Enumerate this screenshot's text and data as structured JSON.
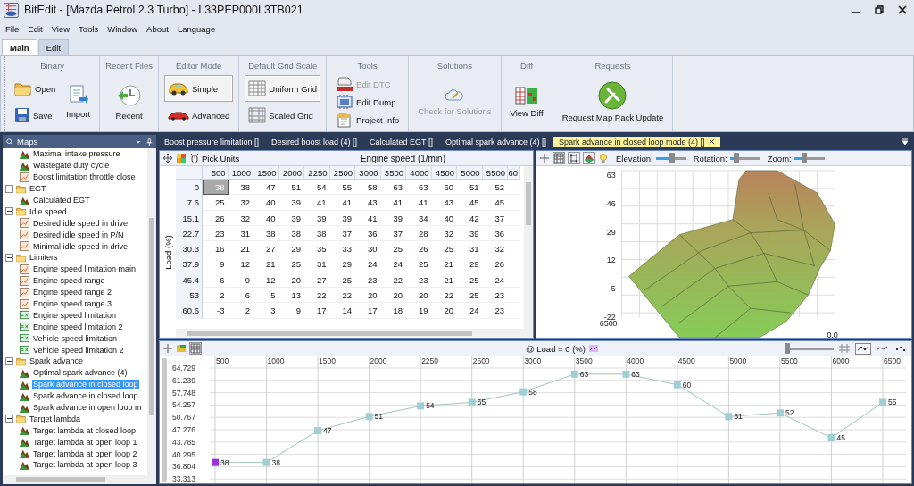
{
  "window": {
    "title": "BitEdit - [Mazda Petrol 2.3 Turbo] - L33PEP000L3TB021"
  },
  "menu": [
    "File",
    "Edit",
    "View",
    "Tools",
    "Window",
    "About",
    "Language"
  ],
  "ribbon_tabs": [
    {
      "label": "Main",
      "selected": true
    },
    {
      "label": "Edit",
      "selected": false
    }
  ],
  "ribbon_groups": [
    {
      "title": "Binary",
      "buttons": [
        {
          "label": "Open",
          "kind": "small",
          "selected": false,
          "disabled": false
        },
        {
          "label": "Save",
          "kind": "small",
          "selected": false,
          "disabled": false
        },
        {
          "label": "Import",
          "kind": "large",
          "selected": false,
          "disabled": false
        }
      ]
    },
    {
      "title": "Recent Files",
      "buttons": [
        {
          "label": "Recent",
          "kind": "large",
          "selected": false,
          "disabled": false
        }
      ]
    },
    {
      "title": "Editor Mode",
      "buttons": [
        {
          "label": "Simple",
          "kind": "small",
          "selected": true,
          "disabled": false
        },
        {
          "label": "Advanced",
          "kind": "small",
          "selected": false,
          "disabled": false
        }
      ]
    },
    {
      "title": "Default Grid Scale",
      "buttons": [
        {
          "label": "Uniform Grid",
          "kind": "small",
          "selected": true,
          "disabled": false
        },
        {
          "label": "Scaled Grid",
          "kind": "small",
          "selected": false,
          "disabled": false
        }
      ]
    },
    {
      "title": "Tools",
      "buttons": [
        {
          "label": "Edit DTC",
          "kind": "small",
          "selected": false,
          "disabled": true
        },
        {
          "label": "Edit Dump",
          "kind": "small",
          "selected": false,
          "disabled": false
        },
        {
          "label": "Project Info",
          "kind": "small",
          "selected": false,
          "disabled": false
        }
      ]
    },
    {
      "title": "Solutions",
      "buttons": [
        {
          "label": "Check for Solutions",
          "kind": "large",
          "selected": false,
          "disabled": true
        }
      ]
    },
    {
      "title": "Diff",
      "buttons": [
        {
          "label": "View Diff",
          "kind": "large",
          "selected": false,
          "disabled": false
        }
      ]
    },
    {
      "title": "Requests",
      "buttons": [
        {
          "label": "Request Map Pack Update",
          "kind": "large",
          "selected": false,
          "disabled": false
        }
      ]
    }
  ],
  "maps_panel": {
    "title": "Maps",
    "tree": [
      {
        "children": [
          {
            "label": "Maximal intake pressure",
            "kind": "map3d",
            "selected": false
          },
          {
            "label": "Wastegate duty cycle",
            "kind": "map3d",
            "selected": false
          },
          {
            "label": "Boost limitation throttle close",
            "kind": "map2d",
            "selected": false
          }
        ]
      },
      {
        "label": "EGT",
        "expanded": true,
        "children": [
          {
            "label": "Calculated EGT",
            "kind": "map3d",
            "selected": false
          }
        ]
      },
      {
        "label": "Idle speed",
        "expanded": true,
        "children": [
          {
            "label": "Desired idle speed in drive",
            "kind": "map2d",
            "selected": false
          },
          {
            "label": "Desired idle speed in P/N",
            "kind": "map2d",
            "selected": false
          },
          {
            "label": "Minimal idle speed in drive",
            "kind": "map2d",
            "selected": false
          }
        ]
      },
      {
        "label": "Limiters",
        "expanded": true,
        "children": [
          {
            "label": "Engine speed limitation main",
            "kind": "map2d",
            "selected": false
          },
          {
            "label": "Engine speed range",
            "kind": "map2d",
            "selected": false
          },
          {
            "label": "Engine speed range 2",
            "kind": "map2d",
            "selected": false
          },
          {
            "label": "Engine speed range 3",
            "kind": "map2d",
            "selected": false
          },
          {
            "label": "Engine speed limitation",
            "kind": "value",
            "selected": false
          },
          {
            "label": "Engine speed limitation 2",
            "kind": "value",
            "selected": false
          },
          {
            "label": "Vehicle speed limitation",
            "kind": "value",
            "selected": false
          },
          {
            "label": "Vehicle speed limitation 2",
            "kind": "value",
            "selected": false
          }
        ]
      },
      {
        "label": "Spark advance",
        "expanded": true,
        "children": [
          {
            "label": "Optimal spark advance (4)",
            "kind": "map3d",
            "selected": false
          },
          {
            "label": "Spark advance in closed loop",
            "kind": "map3d",
            "selected": true
          },
          {
            "label": "Spark advance in closed loop",
            "kind": "map3d",
            "selected": false
          },
          {
            "label": "Spark advance in open loop m",
            "kind": "map3d",
            "selected": false
          }
        ]
      },
      {
        "label": "Target lambda",
        "expanded": true,
        "children": [
          {
            "label": "Target lambda at closed loop",
            "kind": "map3d",
            "selected": false
          },
          {
            "label": "Target lambda at open loop 1",
            "kind": "map3d",
            "selected": false
          },
          {
            "label": "Target lambda at open loop 2",
            "kind": "map3d",
            "selected": false
          },
          {
            "label": "Target lambda at open loop 3",
            "kind": "map3d",
            "selected": false
          }
        ]
      }
    ]
  },
  "doc_tabs": [
    {
      "label": "Boost pressure limitation []",
      "selected": false
    },
    {
      "label": "Desired boost load (4) []",
      "selected": false
    },
    {
      "label": "Calculated EGT []",
      "selected": false
    },
    {
      "label": "Optimal spark advance (4) []",
      "selected": false
    },
    {
      "label": "Spark advance in closed loop mode (4) []",
      "selected": true
    }
  ],
  "table": {
    "pick_units": "Pick Units",
    "x_axis_title": "Engine speed (1/min)",
    "y_axis_title": "Load (%)",
    "columns": [
      "500",
      "1000",
      "1500",
      "2000",
      "2250",
      "2500",
      "3000",
      "3500",
      "4000",
      "4500",
      "5000",
      "5500",
      "60"
    ],
    "rows": [
      {
        "label": "0",
        "cells": [
          {
            "text": "38",
            "selected": true
          },
          {
            "text": "38",
            "selected": false
          },
          {
            "text": "47",
            "selected": false
          },
          {
            "text": "51",
            "selected": false
          },
          {
            "text": "54",
            "selected": false
          },
          {
            "text": "55",
            "selected": false
          },
          {
            "text": "58",
            "selected": false
          },
          {
            "text": "63",
            "selected": false
          },
          {
            "text": "63",
            "selected": false
          },
          {
            "text": "60",
            "selected": false
          },
          {
            "text": "51",
            "selected": false
          },
          {
            "text": "52",
            "selected": false
          }
        ]
      },
      {
        "label": "7.6",
        "cells": [
          {
            "text": "25",
            "selected": false
          },
          {
            "text": "32",
            "selected": false
          },
          {
            "text": "40",
            "selected": false
          },
          {
            "text": "39",
            "selected": false
          },
          {
            "text": "41",
            "selected": false
          },
          {
            "text": "41",
            "selected": false
          },
          {
            "text": "43",
            "selected": false
          },
          {
            "text": "41",
            "selected": false
          },
          {
            "text": "41",
            "selected": false
          },
          {
            "text": "43",
            "selected": false
          },
          {
            "text": "45",
            "selected": false
          },
          {
            "text": "45",
            "selected": false
          }
        ]
      },
      {
        "label": "15.1",
        "cells": [
          {
            "text": "26",
            "selected": false
          },
          {
            "text": "32",
            "selected": false
          },
          {
            "text": "40",
            "selected": false
          },
          {
            "text": "39",
            "selected": false
          },
          {
            "text": "39",
            "selected": false
          },
          {
            "text": "39",
            "selected": false
          },
          {
            "text": "41",
            "selected": false
          },
          {
            "text": "39",
            "selected": false
          },
          {
            "text": "34",
            "selected": false
          },
          {
            "text": "40",
            "selected": false
          },
          {
            "text": "42",
            "selected": false
          },
          {
            "text": "37",
            "selected": false
          }
        ]
      },
      {
        "label": "22.7",
        "cells": [
          {
            "text": "23",
            "selected": false
          },
          {
            "text": "31",
            "selected": false
          },
          {
            "text": "38",
            "selected": false
          },
          {
            "text": "38",
            "selected": false
          },
          {
            "text": "38",
            "selected": false
          },
          {
            "text": "37",
            "selected": false
          },
          {
            "text": "36",
            "selected": false
          },
          {
            "text": "37",
            "selected": false
          },
          {
            "text": "28",
            "selected": false
          },
          {
            "text": "32",
            "selected": false
          },
          {
            "text": "39",
            "selected": false
          },
          {
            "text": "36",
            "selected": false
          }
        ]
      },
      {
        "label": "30.3",
        "cells": [
          {
            "text": "16",
            "selected": false
          },
          {
            "text": "21",
            "selected": false
          },
          {
            "text": "27",
            "selected": false
          },
          {
            "text": "29",
            "selected": false
          },
          {
            "text": "35",
            "selected": false
          },
          {
            "text": "33",
            "selected": false
          },
          {
            "text": "30",
            "selected": false
          },
          {
            "text": "25",
            "selected": false
          },
          {
            "text": "26",
            "selected": false
          },
          {
            "text": "25",
            "selected": false
          },
          {
            "text": "31",
            "selected": false
          },
          {
            "text": "32",
            "selected": false
          }
        ]
      },
      {
        "label": "37.9",
        "cells": [
          {
            "text": "9",
            "selected": false
          },
          {
            "text": "12",
            "selected": false
          },
          {
            "text": "21",
            "selected": false
          },
          {
            "text": "25",
            "selected": false
          },
          {
            "text": "31",
            "selected": false
          },
          {
            "text": "29",
            "selected": false
          },
          {
            "text": "24",
            "selected": false
          },
          {
            "text": "24",
            "selected": false
          },
          {
            "text": "25",
            "selected": false
          },
          {
            "text": "21",
            "selected": false
          },
          {
            "text": "29",
            "selected": false
          },
          {
            "text": "26",
            "selected": false
          }
        ]
      },
      {
        "label": "45.4",
        "cells": [
          {
            "text": "6",
            "selected": false
          },
          {
            "text": "9",
            "selected": false
          },
          {
            "text": "12",
            "selected": false
          },
          {
            "text": "20",
            "selected": false
          },
          {
            "text": "27",
            "selected": false
          },
          {
            "text": "25",
            "selected": false
          },
          {
            "text": "23",
            "selected": false
          },
          {
            "text": "22",
            "selected": false
          },
          {
            "text": "23",
            "selected": false
          },
          {
            "text": "21",
            "selected": false
          },
          {
            "text": "25",
            "selected": false
          },
          {
            "text": "24",
            "selected": false
          }
        ]
      },
      {
        "label": "53",
        "cells": [
          {
            "text": "2",
            "selected": false
          },
          {
            "text": "6",
            "selected": false
          },
          {
            "text": "5",
            "selected": false
          },
          {
            "text": "13",
            "selected": false
          },
          {
            "text": "22",
            "selected": false
          },
          {
            "text": "22",
            "selected": false
          },
          {
            "text": "20",
            "selected": false
          },
          {
            "text": "20",
            "selected": false
          },
          {
            "text": "20",
            "selected": false
          },
          {
            "text": "22",
            "selected": false
          },
          {
            "text": "25",
            "selected": false
          },
          {
            "text": "23",
            "selected": false
          }
        ]
      },
      {
        "label": "60.6",
        "cells": [
          {
            "text": "-3",
            "selected": false
          },
          {
            "text": "2",
            "selected": false
          },
          {
            "text": "3",
            "selected": false
          },
          {
            "text": "9",
            "selected": false
          },
          {
            "text": "17",
            "selected": false
          },
          {
            "text": "14",
            "selected": false
          },
          {
            "text": "17",
            "selected": false
          },
          {
            "text": "18",
            "selected": false
          },
          {
            "text": "19",
            "selected": false
          },
          {
            "text": "20",
            "selected": false
          },
          {
            "text": "24",
            "selected": false
          },
          {
            "text": "23",
            "selected": false
          }
        ]
      }
    ]
  },
  "view3d": {
    "sliders": [
      {
        "label": "Elevation:",
        "level": 0.55
      },
      {
        "label": "Rotation:",
        "level": 0.2
      },
      {
        "label": "Zoom:",
        "level": 0.33
      }
    ],
    "z_ticks": [
      "63",
      "46",
      "29",
      "12",
      "-5",
      "-22"
    ],
    "x_tick": "6500",
    "y_tick": "0.0"
  },
  "graph": {
    "zoom_slider": {
      "level": 0.05
    },
    "view_buttons": [
      {
        "selected": false
      },
      {
        "selected": true
      },
      {
        "selected": false
      },
      {
        "selected": false
      }
    ],
    "chart_data": {
      "type": "line",
      "title": "@ Load = 0 (%)",
      "categories": [
        "500",
        "1000",
        "1500",
        "2000",
        "2250",
        "2500",
        "3000",
        "3500",
        "4000",
        "4500",
        "5000",
        "5500",
        "6000",
        "6500"
      ],
      "series": [
        {
          "color": "#9fcfd6",
          "marker": "square",
          "values": [
            38,
            38,
            47,
            51,
            54,
            55,
            58,
            63,
            63,
            60,
            51,
            52,
            45,
            55
          ]
        }
      ],
      "ylim": [
        33.313,
        64.729
      ],
      "yticks": [
        {
          "value": 64.729,
          "label": "64.729"
        },
        {
          "value": 61.239,
          "label": "61.239"
        },
        {
          "value": 57.748,
          "label": "57.748"
        },
        {
          "value": 54.257,
          "label": "54.257"
        },
        {
          "value": 50.767,
          "label": "50.767"
        },
        {
          "value": 47.276,
          "label": "47.276"
        },
        {
          "value": 43.785,
          "label": "43.785"
        },
        {
          "value": 40.295,
          "label": "40.295"
        },
        {
          "value": 36.804,
          "label": "36.804"
        },
        {
          "value": 33.313,
          "label": "33.313"
        }
      ],
      "data_labels": true,
      "grid": true
    }
  }
}
